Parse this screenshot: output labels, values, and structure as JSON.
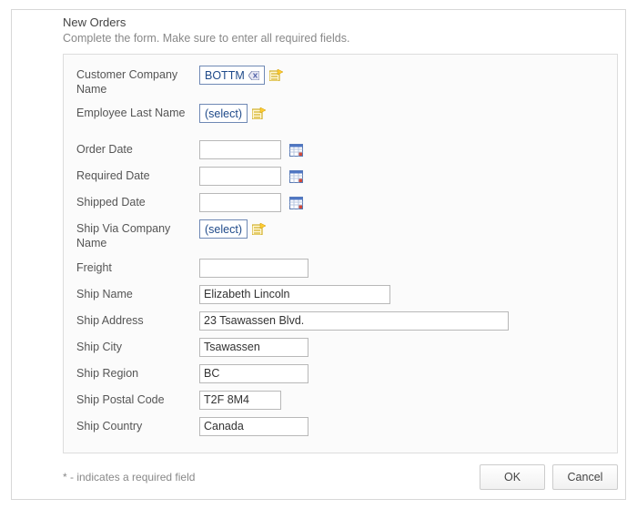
{
  "header": {
    "title": "New Orders",
    "subtitle": "Complete the form. Make sure to enter all required fields."
  },
  "form": {
    "customer_company_name": {
      "label": "Customer Company Name",
      "value": "BOTTM"
    },
    "employee_last_name": {
      "label": "Employee Last Name",
      "placeholder": "(select)"
    },
    "order_date": {
      "label": "Order Date",
      "value": ""
    },
    "required_date": {
      "label": "Required Date",
      "value": ""
    },
    "shipped_date": {
      "label": "Shipped Date",
      "value": ""
    },
    "ship_via_company_name": {
      "label": "Ship Via Company Name",
      "placeholder": "(select)"
    },
    "freight": {
      "label": "Freight",
      "value": ""
    },
    "ship_name": {
      "label": "Ship Name",
      "value": "Elizabeth Lincoln"
    },
    "ship_address": {
      "label": "Ship Address",
      "value": "23 Tsawassen Blvd."
    },
    "ship_city": {
      "label": "Ship City",
      "value": "Tsawassen"
    },
    "ship_region": {
      "label": "Ship Region",
      "value": "BC"
    },
    "ship_postal_code": {
      "label": "Ship Postal Code",
      "value": "T2F 8M4"
    },
    "ship_country": {
      "label": "Ship Country",
      "value": "Canada"
    }
  },
  "footer": {
    "note": "* - indicates a required field",
    "ok_label": "OK",
    "cancel_label": "Cancel"
  },
  "icons": {
    "erase": "erase-icon",
    "new_record": "new-record-icon",
    "calendar": "calendar-icon"
  },
  "colors": {
    "link_blue": "#1f4a8a",
    "border_gray": "#dddddd",
    "muted_text": "#888888"
  }
}
